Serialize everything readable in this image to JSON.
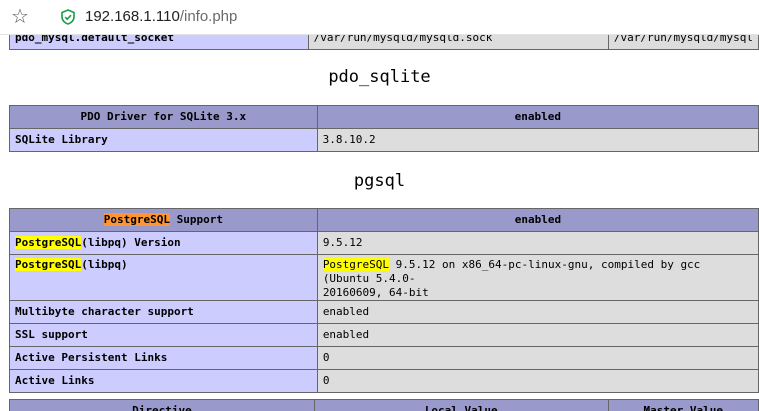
{
  "browser": {
    "url_host": "192.168.1.110",
    "url_path": "/info.php"
  },
  "top_row": {
    "directive": "pdo_mysql.default_socket",
    "local_value": "/var/run/mysqld/mysqld.sock",
    "master_value": "/var/run/mysqld/mysql"
  },
  "pdo_sqlite": {
    "title": "pdo_sqlite",
    "header": {
      "label": "PDO Driver for SQLite 3.x",
      "value": "enabled"
    },
    "rows": [
      {
        "label": "SQLite Library",
        "value": "3.8.10.2"
      }
    ]
  },
  "pgsql": {
    "title": "pgsql",
    "header": {
      "label_hl": "PostgreSQL",
      "label_rest": " Support",
      "value": "enabled"
    },
    "version_row": {
      "label_hl": "PostgreSQL",
      "label_rest": "(libpq) Version",
      "value": "9.5.12"
    },
    "libpq_row": {
      "label_hl": "PostgreSQL",
      "label_rest": "(libpq)",
      "value_hl": "PostgreSQL",
      "value_rest": " 9.5.12 on x86_64-pc-linux-gnu, compiled by gcc (Ubuntu 5.4.0-",
      "value_line2": "20160609, 64-bit"
    },
    "rows": [
      {
        "label": "Multibyte character support",
        "value": "enabled"
      },
      {
        "label": "SSL support",
        "value": "enabled"
      },
      {
        "label": "Active Persistent Links",
        "value": "0"
      },
      {
        "label": "Active Links",
        "value": "0"
      }
    ]
  },
  "bottom_header": {
    "col1": "Directive",
    "col2": "Local Value",
    "col3": "Master Value"
  }
}
